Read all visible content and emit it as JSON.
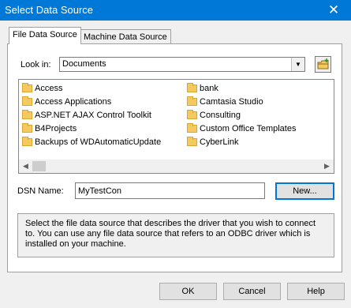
{
  "window": {
    "title": "Select Data Source",
    "close_glyph": "✕"
  },
  "tabs": [
    {
      "label": "File Data Source",
      "active": true
    },
    {
      "label": "Machine Data Source",
      "active": false
    }
  ],
  "look_in": {
    "label": "Look in:",
    "value": "Documents",
    "arrow_glyph": "▼"
  },
  "folders": [
    "Access",
    "Access Applications",
    "ASP.NET AJAX Control Toolkit",
    "B4Projects",
    "Backups of WDAutomaticUpdate",
    "bank",
    "Camtasia Studio",
    "Consulting",
    "Custom Office Templates",
    "CyberLink"
  ],
  "scroll": {
    "left_glyph": "◀",
    "right_glyph": "▶"
  },
  "dsn": {
    "label": "DSN Name:",
    "value": "MyTestCon"
  },
  "buttons": {
    "new": "New...",
    "ok": "OK",
    "cancel": "Cancel",
    "help": "Help"
  },
  "description": "Select the file data source that describes the driver that you wish to connect to. You can use any file data source that refers to an ODBC driver which is installed on your machine.",
  "colors": {
    "titlebar": "#0078d7",
    "focus_border": "#0078d7",
    "folder": "#f4c95d"
  },
  "icons": [
    "close-icon",
    "dropdown-arrow-icon",
    "new-folder-icon",
    "folder-icon",
    "scroll-left-icon",
    "scroll-right-icon"
  ]
}
